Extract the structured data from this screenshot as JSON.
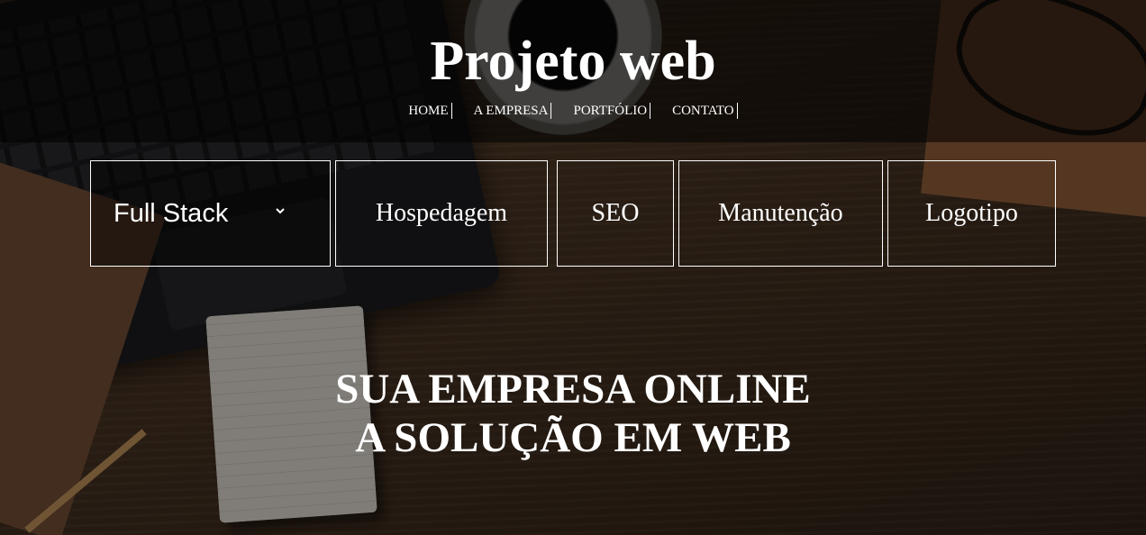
{
  "site": {
    "title": "Projeto web"
  },
  "nav": [
    {
      "label": "HOME"
    },
    {
      "label": "A EMPRESA"
    },
    {
      "label": "PORTFÓLIO"
    },
    {
      "label": "CONTATO"
    }
  ],
  "services": {
    "select": {
      "value": "Full Stack",
      "icon": "chevron-down-icon"
    },
    "items": [
      {
        "label": "Hospedagem"
      },
      {
        "label": "SEO"
      },
      {
        "label": "Manutenção"
      },
      {
        "label": "Logotipo"
      }
    ]
  },
  "hero": {
    "line1": "SUA EMPRESA ONLINE",
    "line2": "A SOLUÇÃO EM WEB"
  },
  "colors": {
    "text": "#ffffff",
    "header_overlay": "rgba(0,0,0,0.55)"
  }
}
